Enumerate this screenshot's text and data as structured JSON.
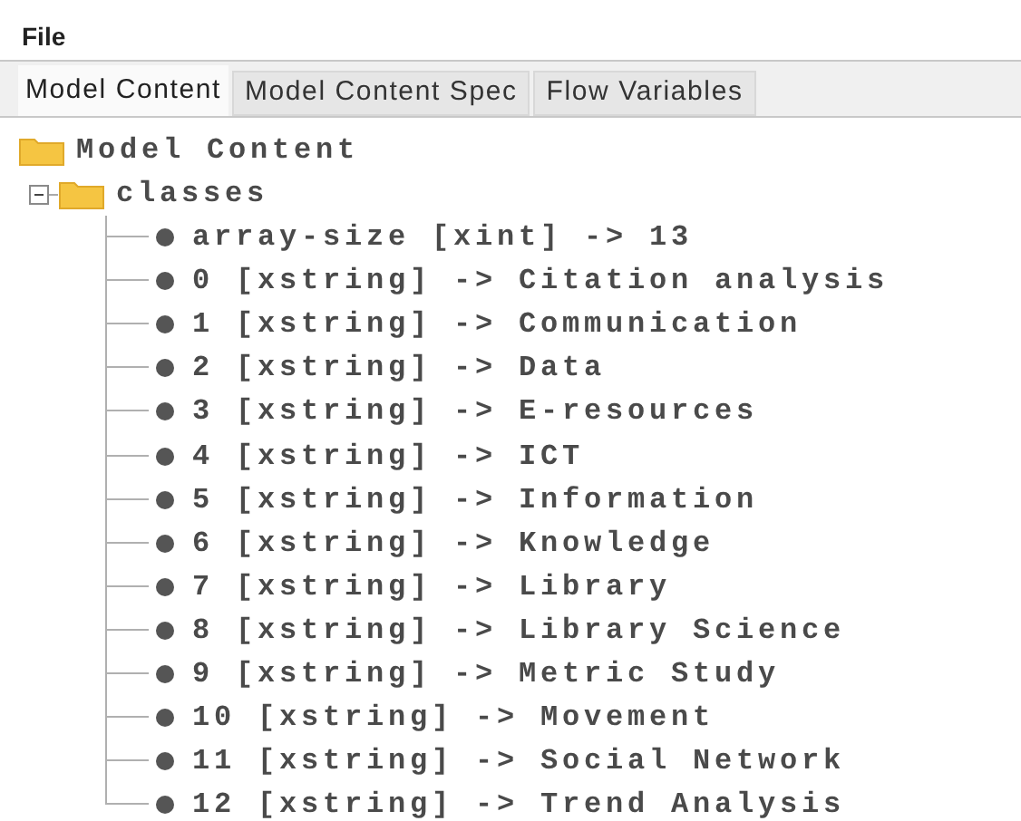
{
  "menu": [
    "File"
  ],
  "tabs": [
    {
      "label": "Model Content",
      "selected": true
    },
    {
      "label": "Model Content Spec",
      "selected": false
    },
    {
      "label": "Flow Variables",
      "selected": false
    }
  ],
  "tree": {
    "label": "Model Content",
    "children": [
      {
        "label": "classes",
        "expanded": true,
        "children": [
          {
            "label": "array-size [xint] -> 13"
          },
          {
            "label": "0 [xstring] -> Citation analysis"
          },
          {
            "label": "1 [xstring] -> Communication"
          },
          {
            "label": "2 [xstring] -> Data"
          },
          {
            "label": "3 [xstring] -> E-resources"
          },
          {
            "label": "4 [xstring] -> ICT"
          },
          {
            "label": "5 [xstring] -> Information"
          },
          {
            "label": "6 [xstring] -> Knowledge"
          },
          {
            "label": "7 [xstring] -> Library"
          },
          {
            "label": "8 [xstring] -> Library Science"
          },
          {
            "label": "9 [xstring] -> Metric Study"
          },
          {
            "label": "10 [xstring] -> Movement"
          },
          {
            "label": "11 [xstring] -> Social Network"
          },
          {
            "label": "12 [xstring] -> Trend Analysis"
          }
        ]
      }
    ]
  }
}
